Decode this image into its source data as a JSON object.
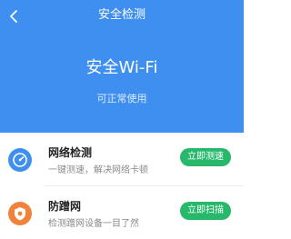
{
  "nav": {
    "title": "安全检测"
  },
  "status": {
    "title": "安全Wi-Fi",
    "subtitle": "可正常使用"
  },
  "items": [
    {
      "title": "网络检测",
      "desc": "一键测速，解决网络卡顿",
      "action": "立即测速",
      "icon": "speedometer-icon",
      "icon_color": "#3f8ff0"
    },
    {
      "title": "防蹭网",
      "desc": "检测蹭网设备一目了然",
      "action": "立即扫描",
      "icon": "shield-scan-icon",
      "icon_color": "#f0823a"
    }
  ],
  "colors": {
    "header_bg": "#3f8ff0",
    "action_bg": "#27b86c"
  }
}
